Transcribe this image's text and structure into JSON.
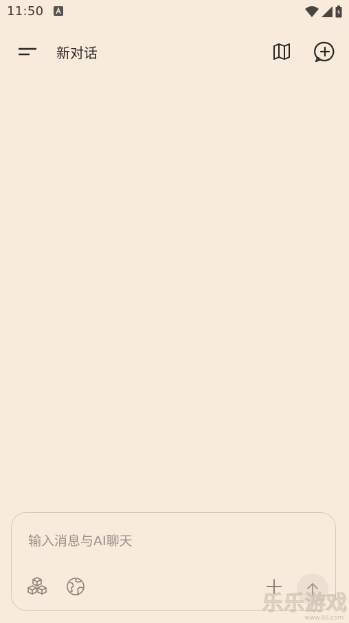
{
  "status_bar": {
    "time": "11:50",
    "icons": [
      "android-notification-icon",
      "wifi-icon",
      "cellular-signal-icon",
      "battery-icon"
    ]
  },
  "app_bar": {
    "title": "新对话",
    "icons": {
      "menu": "menu-icon",
      "map": "map-icon",
      "new_chat": "new-chat-icon"
    }
  },
  "composer": {
    "placeholder": "输入消息与AI聊天",
    "value": "",
    "tools": [
      "models-cubes-icon",
      "globe-icon",
      "plus-icon",
      "arrow-up-icon"
    ]
  },
  "watermark": {
    "main": "乐乐游戏",
    "sub": "· www.6ll.com ·"
  },
  "colors": {
    "background": "#f8ebdc",
    "text_primary": "#2b2723",
    "placeholder": "#9a9189",
    "icon_muted": "#8c8278",
    "border": "#d8cabb"
  }
}
